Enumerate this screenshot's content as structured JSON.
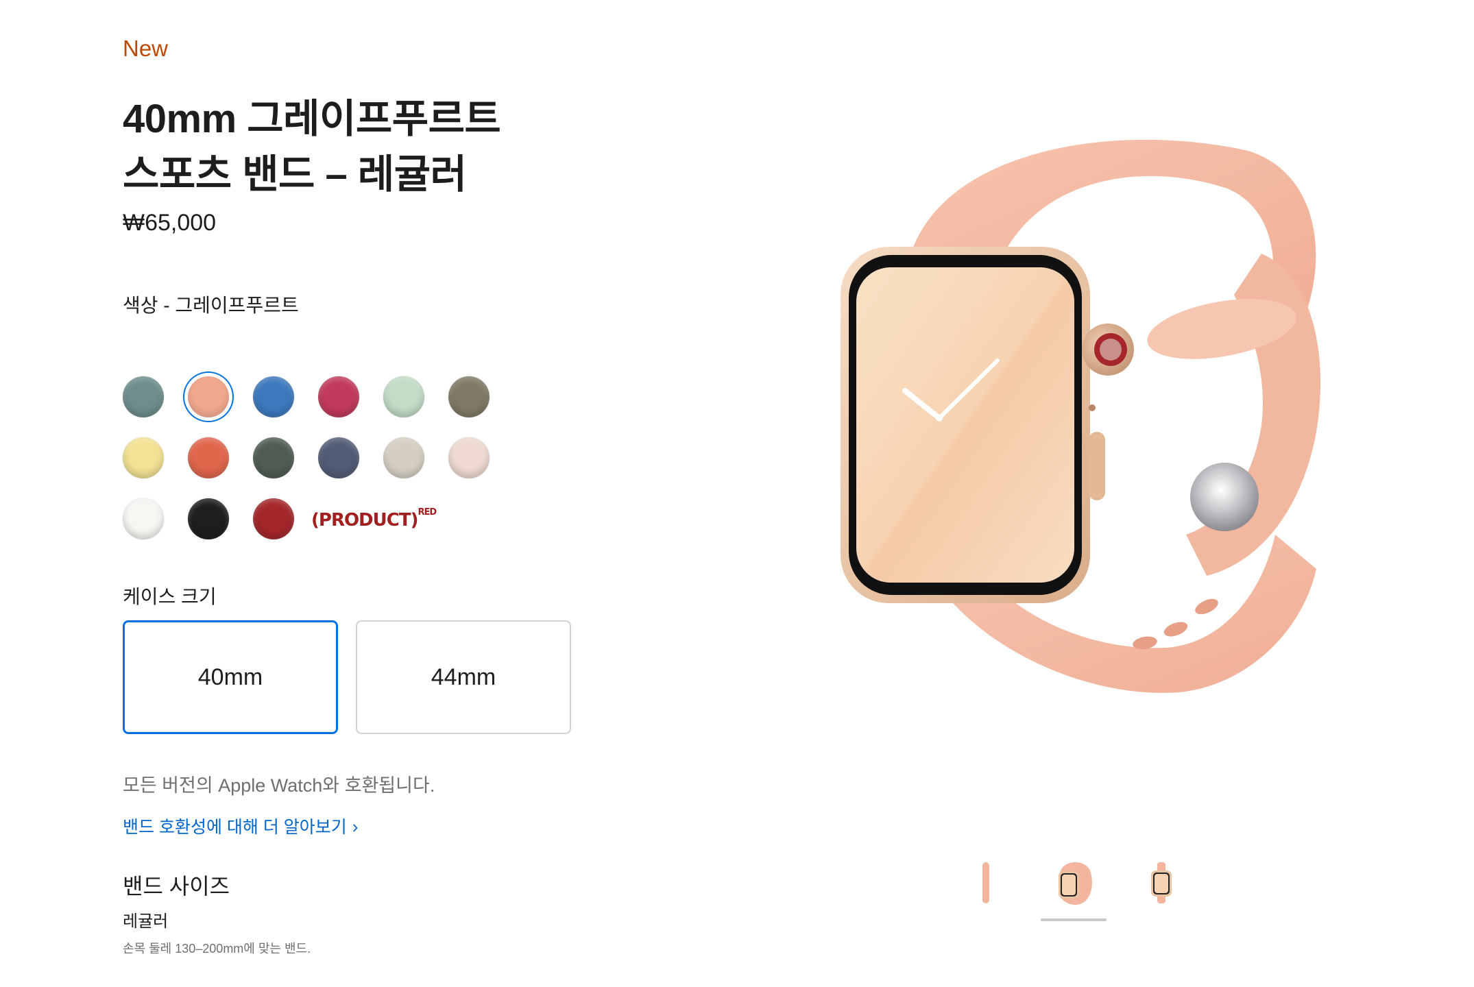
{
  "product": {
    "badge": "New",
    "title_line1": "40mm 그레이프푸르트",
    "title_line2": "스포츠 밴드 – 레귤러",
    "price": "₩65,000"
  },
  "color": {
    "label": "색상 - 그레이프푸르트",
    "selected_index": 1,
    "swatches": [
      [
        "#6d8e8c",
        "#f0a88f",
        "#3c79bd",
        "#c23a5c",
        "#c2dcc6",
        "#7f7a66"
      ],
      [
        "#f3e293",
        "#e0664c",
        "#4f5d52",
        "#525c76",
        "#d5cfc3",
        "#efd9d1"
      ],
      [
        "#f8f6f3",
        "#1e1e1e",
        "#a3262a"
      ]
    ],
    "product_red": "(PRODUCT)",
    "product_red_sup": "RED"
  },
  "case_size": {
    "label": "케이스 크기",
    "options": [
      "40mm",
      "44mm"
    ],
    "selected": "40mm"
  },
  "compatibility": {
    "note": "모든 버전의 Apple Watch와 호환됩니다.",
    "link": "밴드 호환성에 대해 더 알아보기"
  },
  "band_size": {
    "title": "밴드 사이즈",
    "value": "레귤러",
    "description": "손목 둘레 130–200mm에 맞는 밴드."
  },
  "colors": {
    "accent": "#0071e3",
    "badge": "#bf4800",
    "link": "#0066cc",
    "band": "#f3b59e",
    "case": "#ecc8a9"
  },
  "thumbnails": {
    "count": 3,
    "active_index": 1
  }
}
